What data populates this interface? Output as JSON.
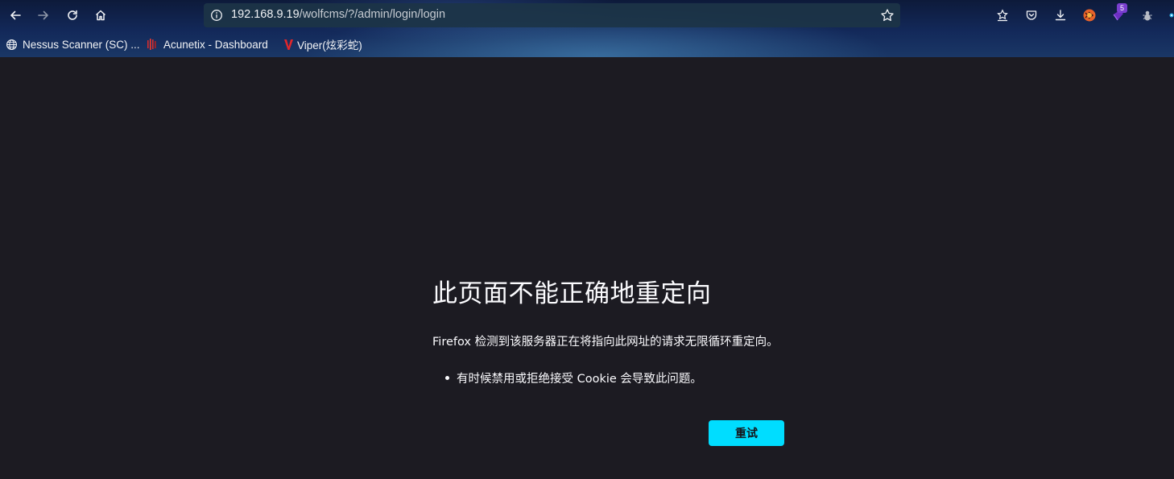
{
  "browser": {
    "url_host": "192.168.9.19",
    "url_path": "/wolfcms/?/admin/login/login",
    "extension_badge_count": "5",
    "icons": {
      "back": "back-arrow-icon",
      "forward": "forward-arrow-icon",
      "reload": "reload-icon",
      "home": "home-icon",
      "site_info": "info-icon",
      "bookmark_star": "star-icon",
      "library": "library-icon",
      "pocket": "pocket-icon",
      "downloads": "download-icon",
      "extensions": [
        "fox-extension-icon",
        "purple-extension-icon",
        "bug-extension-icon",
        "firefox-account-icon"
      ]
    }
  },
  "bookmarks": [
    {
      "label": "Nessus Scanner (SC) ...",
      "icon": "globe-icon"
    },
    {
      "label": "Acunetix - Dashboard",
      "icon": "acunetix-icon"
    },
    {
      "label": "Viper(炫彩蛇)",
      "icon": "viper-v-icon"
    }
  ],
  "error_page": {
    "title": "此页面不能正确地重定向",
    "description": "Firefox 检测到该服务器正在将指向此网址的请求无限循环重定向。",
    "bullets": [
      "有时候禁用或拒绝接受 Cookie 会导致此问题。"
    ],
    "retry_label": "重试"
  },
  "colors": {
    "page_background": "#1c1b22",
    "accent_button": "#00ddff",
    "text": "#fbfbfe"
  }
}
